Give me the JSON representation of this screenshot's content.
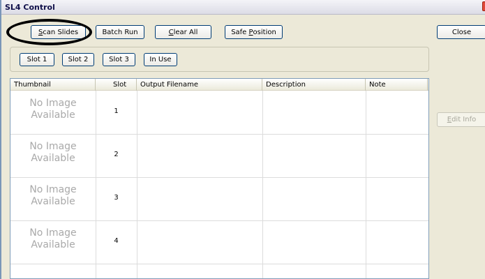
{
  "window": {
    "title": "SL4 Control"
  },
  "toolbar": {
    "scan_slides": {
      "mnemonic": "S",
      "rest": "can Slides"
    },
    "batch_run": "Batch Run",
    "clear_all": {
      "mnemonic": "C",
      "rest": "lear All"
    },
    "safe_position": {
      "prefix": "Safe ",
      "mnemonic": "P",
      "rest": "osition"
    },
    "close": "Close"
  },
  "slot_buttons": [
    "Slot 1",
    "Slot 2",
    "Slot 3",
    "In Use"
  ],
  "table": {
    "columns": [
      "Thumbnail",
      "Slot",
      "Output Filename",
      "Description",
      "Note"
    ],
    "rows": [
      {
        "thumbnail_line1": "No Image",
        "thumbnail_line2": "Available",
        "slot": "1",
        "output_filename": "",
        "description": "",
        "note": ""
      },
      {
        "thumbnail_line1": "No Image",
        "thumbnail_line2": "Available",
        "slot": "2",
        "output_filename": "",
        "description": "",
        "note": ""
      },
      {
        "thumbnail_line1": "No Image",
        "thumbnail_line2": "Available",
        "slot": "3",
        "output_filename": "",
        "description": "",
        "note": ""
      },
      {
        "thumbnail_line1": "No Image",
        "thumbnail_line2": "Available",
        "slot": "4",
        "output_filename": "",
        "description": "",
        "note": ""
      }
    ]
  },
  "edit_info": {
    "mnemonic": "E",
    "rest": "dit Info",
    "enabled": false
  },
  "annotation": {
    "shape": "oval",
    "target": "scan-slides-button",
    "color": "#000000"
  }
}
